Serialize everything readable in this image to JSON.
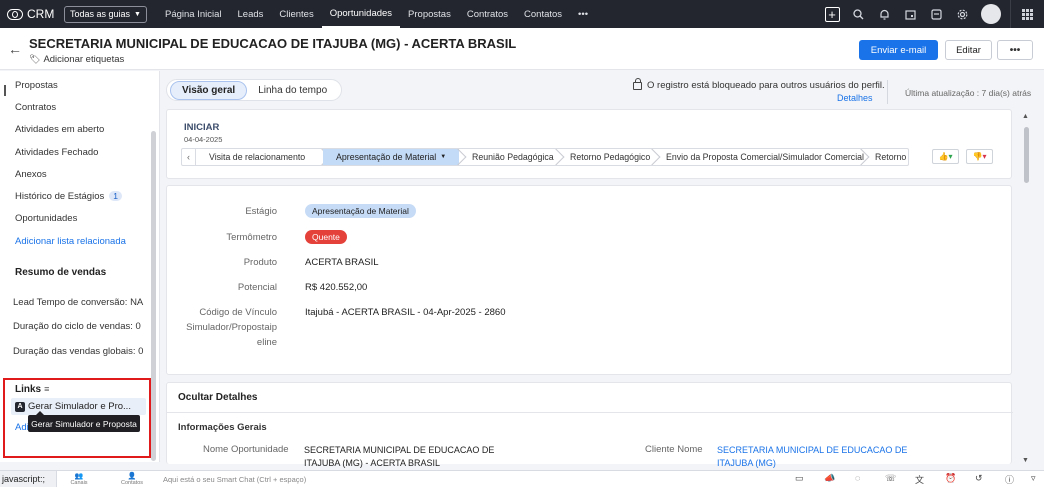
{
  "topnav": {
    "brand": "CRM",
    "guides_label": "Todas as guias",
    "items": [
      "Página Inicial",
      "Leads",
      "Clientes",
      "Oportunidades",
      "Propostas",
      "Contratos",
      "Contatos",
      "•••"
    ],
    "active_item": "Oportunidades"
  },
  "header": {
    "title": "SECRETARIA MUNICIPAL DE EDUCACAO DE ITAJUBA (MG) - ACERTA BRASIL",
    "tags_label": "Adicionar etiquetas",
    "send_email": "Enviar e-mail",
    "edit": "Editar",
    "more": "•••"
  },
  "sidebar": {
    "items": [
      {
        "label": "Propostas"
      },
      {
        "label": "Contratos"
      },
      {
        "label": "Atividades em aberto"
      },
      {
        "label": "Atividades Fechado"
      },
      {
        "label": "Anexos"
      },
      {
        "label": "Histórico de Estágios",
        "badge": "1"
      },
      {
        "label": "Oportunidades"
      }
    ],
    "add_related": "Adicionar lista relacionada",
    "sales_summary_title": "Resumo de vendas",
    "summary": [
      "Lead Tempo de conversão: NA",
      "Duração do ciclo de vendas: 0",
      "Duração das vendas globais: 0"
    ],
    "links_title": "Links",
    "link_item": "Gerar Simulador e Pro...",
    "link_add": "Adi",
    "tooltip": "Gerar Simulador e Proposta"
  },
  "tabs": {
    "overview": "Visão geral",
    "timeline": "Linha do tempo",
    "lock_message": "O registro está bloqueado para outros usuários do perfil.",
    "details": "Detalhes",
    "last_update": "Última atualização : 7 dia(s) atrás"
  },
  "stage": {
    "label": "INICIAR",
    "date": "04-04-2025",
    "steps": [
      "Visita de relacionamento",
      "Apresentação de Material",
      "Reunião Pedagógica",
      "Retorno Pedagógico",
      "Envio da Proposta Comercial/Simulador Comercial",
      "Retorno da Propo"
    ],
    "current_step": "Apresentação de Material"
  },
  "fields": {
    "estagio_label": "Estágio",
    "estagio_value": "Apresentação de Material",
    "termometro_label": "Termômetro",
    "termometro_value": "Quente",
    "produto_label": "Produto",
    "produto_value": "ACERTA BRASIL",
    "potencial_label": "Potencial",
    "potencial_value": "R$ 420.552,00",
    "codigo_label_1": "Código de Vínculo",
    "codigo_label_2": "Simulador/Propostaip",
    "codigo_label_3": "eline",
    "codigo_value": "Itajubá - ACERTA BRASIL - 04-Apr-2025 - 2860"
  },
  "info": {
    "hide_details": "Ocultar Detalhes",
    "section_title": "Informações Gerais",
    "nome_label": "Nome Oportunidade",
    "nome_value": "SECRETARIA MUNICIPAL DE EDUCACAO DE ITAJUBA (MG) - ACERTA BRASIL",
    "cliente_label": "Cliente Nome",
    "cliente_value": "SECRETARIA MUNICIPAL DE EDUCACAO DE ITAJUBA (MG)"
  },
  "bottombar": {
    "status": "javascript:;",
    "canais": "Canais",
    "contatos": "Contatos",
    "chat_placeholder": "Aqui está o seu Smart Chat (Ctrl + espaço)"
  },
  "colors": {
    "nav_bg": "#23262f",
    "primary": "#1a73e8",
    "hot": "#e4413a",
    "stage_current": "#c4dbf7",
    "highlight_border": "#e01a1a"
  }
}
